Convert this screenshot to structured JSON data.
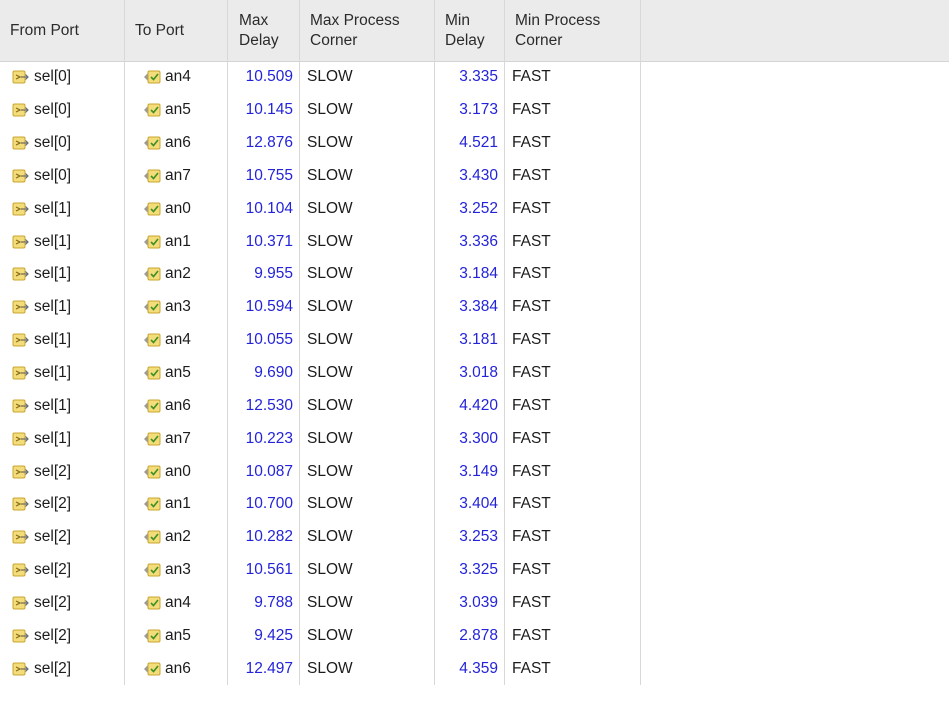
{
  "columns": {
    "from_port": "From Port",
    "to_port": "To Port",
    "max_delay_1": "Max",
    "max_delay_2": "Delay",
    "max_corner_1": "Max Process",
    "max_corner_2": "Corner",
    "min_delay_1": "Min",
    "min_delay_2": "Delay",
    "min_corner_1": "Min Process",
    "min_corner_2": "Corner"
  },
  "icons": {
    "from_port_icon": "input-port-arrow-icon",
    "to_port_icon": "output-port-check-icon"
  },
  "colors": {
    "delay_value": "#2323d9",
    "header_bg": "#ebebeb",
    "icon_yellow": "#e8c547"
  },
  "rows": [
    {
      "from": "sel[0]",
      "to": "an4",
      "max_delay": "10.509",
      "max_corner": "SLOW",
      "min_delay": "3.335",
      "min_corner": "FAST"
    },
    {
      "from": "sel[0]",
      "to": "an5",
      "max_delay": "10.145",
      "max_corner": "SLOW",
      "min_delay": "3.173",
      "min_corner": "FAST"
    },
    {
      "from": "sel[0]",
      "to": "an6",
      "max_delay": "12.876",
      "max_corner": "SLOW",
      "min_delay": "4.521",
      "min_corner": "FAST"
    },
    {
      "from": "sel[0]",
      "to": "an7",
      "max_delay": "10.755",
      "max_corner": "SLOW",
      "min_delay": "3.430",
      "min_corner": "FAST"
    },
    {
      "from": "sel[1]",
      "to": "an0",
      "max_delay": "10.104",
      "max_corner": "SLOW",
      "min_delay": "3.252",
      "min_corner": "FAST"
    },
    {
      "from": "sel[1]",
      "to": "an1",
      "max_delay": "10.371",
      "max_corner": "SLOW",
      "min_delay": "3.336",
      "min_corner": "FAST"
    },
    {
      "from": "sel[1]",
      "to": "an2",
      "max_delay": "9.955",
      "max_corner": "SLOW",
      "min_delay": "3.184",
      "min_corner": "FAST"
    },
    {
      "from": "sel[1]",
      "to": "an3",
      "max_delay": "10.594",
      "max_corner": "SLOW",
      "min_delay": "3.384",
      "min_corner": "FAST"
    },
    {
      "from": "sel[1]",
      "to": "an4",
      "max_delay": "10.055",
      "max_corner": "SLOW",
      "min_delay": "3.181",
      "min_corner": "FAST"
    },
    {
      "from": "sel[1]",
      "to": "an5",
      "max_delay": "9.690",
      "max_corner": "SLOW",
      "min_delay": "3.018",
      "min_corner": "FAST"
    },
    {
      "from": "sel[1]",
      "to": "an6",
      "max_delay": "12.530",
      "max_corner": "SLOW",
      "min_delay": "4.420",
      "min_corner": "FAST"
    },
    {
      "from": "sel[1]",
      "to": "an7",
      "max_delay": "10.223",
      "max_corner": "SLOW",
      "min_delay": "3.300",
      "min_corner": "FAST"
    },
    {
      "from": "sel[2]",
      "to": "an0",
      "max_delay": "10.087",
      "max_corner": "SLOW",
      "min_delay": "3.149",
      "min_corner": "FAST"
    },
    {
      "from": "sel[2]",
      "to": "an1",
      "max_delay": "10.700",
      "max_corner": "SLOW",
      "min_delay": "3.404",
      "min_corner": "FAST"
    },
    {
      "from": "sel[2]",
      "to": "an2",
      "max_delay": "10.282",
      "max_corner": "SLOW",
      "min_delay": "3.253",
      "min_corner": "FAST"
    },
    {
      "from": "sel[2]",
      "to": "an3",
      "max_delay": "10.561",
      "max_corner": "SLOW",
      "min_delay": "3.325",
      "min_corner": "FAST"
    },
    {
      "from": "sel[2]",
      "to": "an4",
      "max_delay": "9.788",
      "max_corner": "SLOW",
      "min_delay": "3.039",
      "min_corner": "FAST"
    },
    {
      "from": "sel[2]",
      "to": "an5",
      "max_delay": "9.425",
      "max_corner": "SLOW",
      "min_delay": "2.878",
      "min_corner": "FAST"
    },
    {
      "from": "sel[2]",
      "to": "an6",
      "max_delay": "12.497",
      "max_corner": "SLOW",
      "min_delay": "4.359",
      "min_corner": "FAST"
    }
  ]
}
